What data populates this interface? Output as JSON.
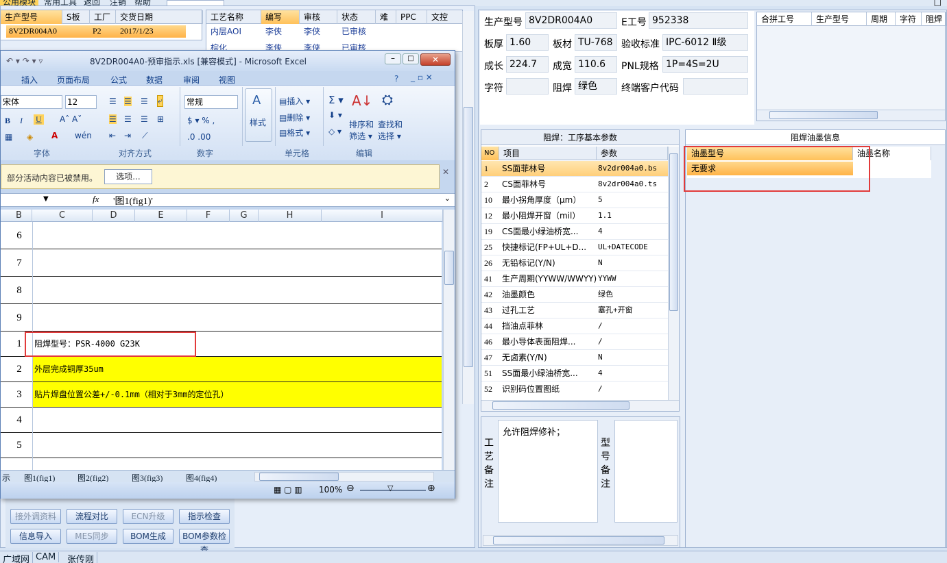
{
  "topmenu": {
    "items": [
      "公用模块",
      "常用工具",
      "返回",
      "注销",
      "帮助"
    ]
  },
  "left_grid": {
    "headers": [
      "生产型号",
      "S板",
      "工厂",
      "交货日期"
    ],
    "row": {
      "model": "8V2DR004A0",
      "factory": "P2",
      "date": "2017/1/23"
    }
  },
  "mid_grid": {
    "headers": [
      "工艺名称",
      "编写",
      "审核",
      "状态",
      "难",
      "PPC",
      "文控"
    ],
    "rows": [
      {
        "name": "内层AOI",
        "writer": "李侠",
        "reviewer": "李侠",
        "status": "已审核"
      },
      {
        "name": "棕化",
        "writer": "李侠",
        "reviewer": "李侠",
        "status": "已审核"
      }
    ]
  },
  "excel": {
    "title": "8V2DR004A0-预审指示.xls  [兼容模式] - Microsoft Excel",
    "tabs": [
      "插入",
      "页面布局",
      "公式",
      "数据",
      "审阅",
      "视图"
    ],
    "font_name": "宋体",
    "font_size": "12",
    "number_format": "常规",
    "group_font": "字体",
    "group_align": "对齐方式",
    "group_number": "数字",
    "group_cells": "单元格",
    "group_edit": "编辑",
    "style_label": "样式",
    "insert_label": "插入",
    "delete_label": "删除",
    "format_label": "格式",
    "sort_label": "排序和",
    "sort_label2": "筛选",
    "find_label": "查找和",
    "find_label2": "选择",
    "message": "部分活动内容已被禁用。",
    "options_button": "选项...",
    "formula": "'图1(fig1)'",
    "fx": "fx",
    "columns": [
      "B",
      "C",
      "D",
      "E",
      "F",
      "G",
      "H",
      "I"
    ],
    "rows": [
      {
        "num": "6",
        "text": ""
      },
      {
        "num": "7",
        "text": ""
      },
      {
        "num": "8",
        "text": ""
      },
      {
        "num": "9",
        "text": ""
      },
      {
        "num": "1",
        "text": "阻焊型号：PSR-4000 G23K"
      },
      {
        "num": "2",
        "text": "外层完成铜厚35um"
      },
      {
        "num": "3",
        "text": "贴片焊盘位置公差+/-0.1mm（相对于3mm的定位孔）"
      },
      {
        "num": "4",
        "text": ""
      },
      {
        "num": "5",
        "text": ""
      }
    ],
    "sheet_tabs": [
      "示",
      "图1(fig1)",
      "图2(fig2)",
      "图3(fig3)",
      "图4(fig4)"
    ],
    "zoom": "100%"
  },
  "left_buttons": [
    {
      "label": "接外调资料",
      "disabled": true
    },
    {
      "label": "流程对比",
      "disabled": false
    },
    {
      "label": "ECN升级",
      "disabled": true
    },
    {
      "label": "指示检查",
      "disabled": false
    },
    {
      "label": "信息导入",
      "disabled": false
    },
    {
      "label": "MES同步",
      "disabled": true
    },
    {
      "label": "BOM生成",
      "disabled": false
    },
    {
      "label": "BOM参数检查",
      "disabled": false
    }
  ],
  "info": {
    "model_label": "生产型号",
    "model": "8V2DR004A0",
    "eno_label": "E工号",
    "eno": "952338",
    "thick_label": "板厚",
    "thick": "1.60",
    "material_label": "板材",
    "material": "TU-768",
    "accept_label": "验收标准",
    "accept": "IPC-6012 Ⅱ级",
    "length_label": "成长",
    "length": "224.7",
    "width_label": "成宽",
    "width": "110.6",
    "pnl_label": "PNL规格",
    "pnl": "1P=4S=2U",
    "char_label": "字符",
    "char": "",
    "mask_label": "阻焊",
    "mask": "绿色",
    "customer_label": "终端客户代码",
    "customer": ""
  },
  "combine_grid": {
    "headers": [
      "合拼工号",
      "生产型号",
      "周期",
      "字符",
      "阻焊"
    ]
  },
  "params": {
    "title": "阻焊：工序基本参数",
    "headers": [
      "NO",
      "项目",
      "参数"
    ],
    "rows": [
      {
        "no": "1",
        "item": "SS面菲林号",
        "val": "8v2dr004a0.bs"
      },
      {
        "no": "2",
        "item": "CS面菲林号",
        "val": "8v2dr004a0.ts"
      },
      {
        "no": "10",
        "item": "最小拐角厚度（μm）",
        "val": "5"
      },
      {
        "no": "12",
        "item": "最小阻焊开窗（mil）",
        "val": "1.1"
      },
      {
        "no": "19",
        "item": "CS面最小绿油桥宽...",
        "val": "4"
      },
      {
        "no": "25",
        "item": "快捷标记(FP+UL+D...",
        "val": "UL+DATECODE"
      },
      {
        "no": "26",
        "item": "无铅标记(Y/N)",
        "val": "N"
      },
      {
        "no": "41",
        "item": "生产周期(YYWW/WWYY)",
        "val": "YYWW"
      },
      {
        "no": "42",
        "item": "油墨颜色",
        "val": "绿色"
      },
      {
        "no": "43",
        "item": "过孔工艺",
        "val": "塞孔+开窗"
      },
      {
        "no": "44",
        "item": "挡油点菲林",
        "val": "/"
      },
      {
        "no": "46",
        "item": "最小导体表面阻焊...",
        "val": "/"
      },
      {
        "no": "47",
        "item": "无卤素(Y/N)",
        "val": "N"
      },
      {
        "no": "51",
        "item": "SS面最小绿油桥宽...",
        "val": "4"
      },
      {
        "no": "52",
        "item": "识别码位置图纸",
        "val": "/"
      }
    ]
  },
  "ink": {
    "title": "阻焊油墨信息",
    "headers": [
      "油墨型号",
      "油墨名称"
    ],
    "row": "无要求"
  },
  "notes": {
    "process_label": "工艺备注",
    "process_text": "允许阻焊修补；",
    "model_label": "型号备注"
  },
  "bottom": {
    "items": [
      "广域网",
      "CAM",
      "张传刚"
    ]
  }
}
